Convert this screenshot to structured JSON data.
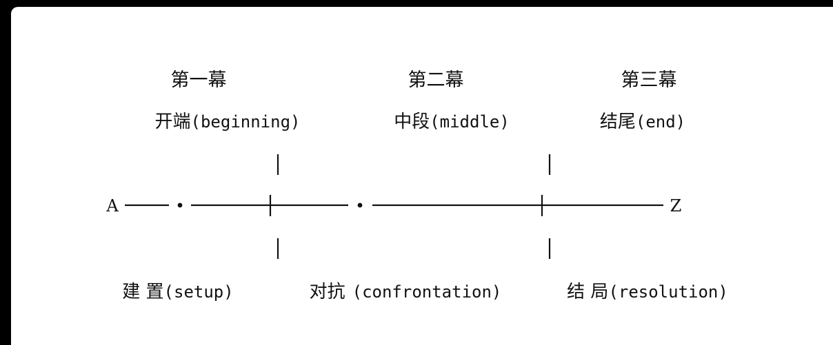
{
  "acts": [
    {
      "title": "第一幕",
      "name": "开端",
      "latin": "(beginning)"
    },
    {
      "title": "第二幕",
      "name": "中段",
      "latin": "(middle)"
    },
    {
      "title": "第三幕",
      "name": "结尾",
      "latin": "(end)"
    }
  ],
  "phases": [
    {
      "name": "建 置",
      "latin": "(setup)"
    },
    {
      "name": "对抗",
      "latin": "(confrontation)"
    },
    {
      "name": "结 局",
      "latin": "(resolution)"
    }
  ],
  "timeline": {
    "start_label": "A",
    "end_label": "Z"
  },
  "colors": {
    "background": "#ffffff",
    "ink": "#111111",
    "outer": "#000000"
  }
}
